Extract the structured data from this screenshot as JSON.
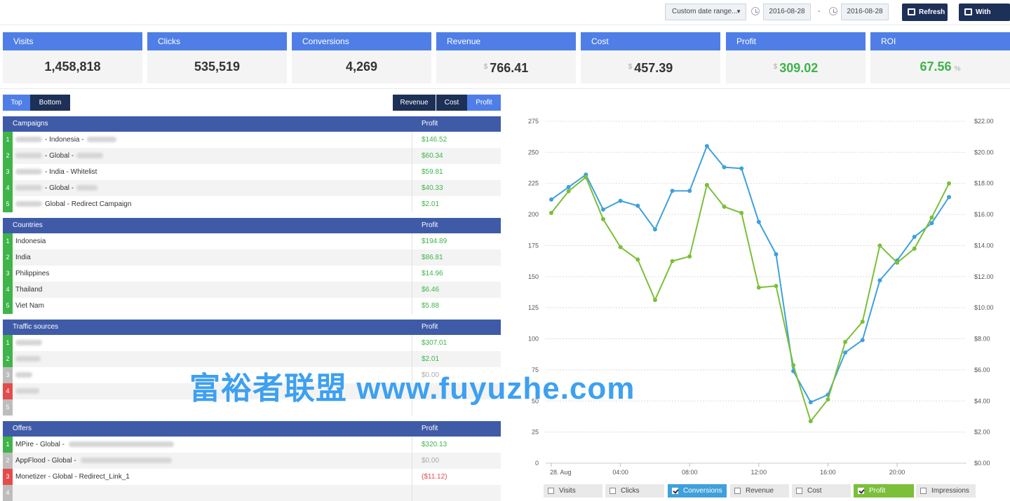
{
  "topbar": {
    "date_range_select": "Custom date range...",
    "date_from": "2016-08-28",
    "date_sep": "-",
    "date_to": "2016-08-28",
    "refresh_label": "Refresh",
    "with_traffic_label": "With traffic"
  },
  "kpis": [
    {
      "label": "Visits",
      "value": "1,458,818",
      "prefix": "",
      "suffix": ""
    },
    {
      "label": "Clicks",
      "value": "535,519",
      "prefix": "",
      "suffix": ""
    },
    {
      "label": "Conversions",
      "value": "4,269",
      "prefix": "",
      "suffix": ""
    },
    {
      "label": "Revenue",
      "value": "766.41",
      "prefix": "$",
      "suffix": ""
    },
    {
      "label": "Cost",
      "value": "457.39",
      "prefix": "$",
      "suffix": ""
    },
    {
      "label": "Profit",
      "value": "309.02",
      "prefix": "$",
      "suffix": ""
    },
    {
      "label": "ROI",
      "value": "67.56",
      "prefix": "",
      "suffix": "%"
    }
  ],
  "toggles": {
    "top": "Top",
    "bottom": "Bottom",
    "revenue": "Revenue",
    "cost": "Cost",
    "profit": "Profit"
  },
  "tables": [
    {
      "title": "Campaigns",
      "metric": "Profit",
      "rows": [
        {
          "rank": "1",
          "name": "- Indonesia -",
          "value": "$146.52",
          "status": "green"
        },
        {
          "rank": "2",
          "name": "- Global -",
          "value": "$60.34",
          "status": "green"
        },
        {
          "rank": "3",
          "name": "- India - Whitelist",
          "value": "$59.81",
          "status": "green"
        },
        {
          "rank": "4",
          "name": "- Global -",
          "value": "$40.33",
          "status": "green"
        },
        {
          "rank": "5",
          "name": "Global - Redirect Campaign",
          "value": "$2.01",
          "status": "green"
        }
      ]
    },
    {
      "title": "Countries",
      "metric": "Profit",
      "rows": [
        {
          "rank": "1",
          "name": "Indonesia",
          "value": "$194.89",
          "status": "green"
        },
        {
          "rank": "2",
          "name": "India",
          "value": "$86.81",
          "status": "green"
        },
        {
          "rank": "3",
          "name": "Philippines",
          "value": "$14.96",
          "status": "green"
        },
        {
          "rank": "4",
          "name": "Thailand",
          "value": "$6.46",
          "status": "green"
        },
        {
          "rank": "5",
          "name": "Viet Nam",
          "value": "$5.88",
          "status": "green"
        }
      ]
    },
    {
      "title": "Traffic sources",
      "metric": "Profit",
      "rows": [
        {
          "rank": "1",
          "name": "",
          "value": "$307.01",
          "status": "green"
        },
        {
          "rank": "2",
          "name": "",
          "value": "$2.01",
          "status": "green"
        },
        {
          "rank": "3",
          "name": "",
          "value": "$0.00",
          "status": "gray"
        },
        {
          "rank": "4",
          "name": "",
          "value": "",
          "status": "red"
        },
        {
          "rank": "5",
          "name": "",
          "value": "",
          "status": "gray"
        }
      ]
    },
    {
      "title": "Offers",
      "metric": "Profit",
      "rows": [
        {
          "rank": "1",
          "name": "MPire - Global -",
          "value": "$320.13",
          "status": "green"
        },
        {
          "rank": "2",
          "name": "AppFlood - Global -",
          "value": "$0.00",
          "status": "gray"
        },
        {
          "rank": "3",
          "name": "Monetizer - Global - Redirect_Link_1",
          "value": "($11.12)",
          "status": "red"
        },
        {
          "rank": "4",
          "name": "",
          "value": "",
          "status": "gray"
        }
      ]
    }
  ],
  "colors": {
    "green": "#3eb44a",
    "red": "#e54b4b",
    "gray": "#bdbdbd",
    "header": "#3f5ba8",
    "kpi": "#4f7fe6",
    "navy": "#1d3057"
  },
  "legend": [
    {
      "label": "Visits",
      "checked": false,
      "color": ""
    },
    {
      "label": "Clicks",
      "checked": false,
      "color": ""
    },
    {
      "label": "Conversions",
      "checked": true,
      "color": "#3fa0dc"
    },
    {
      "label": "Revenue",
      "checked": false,
      "color": ""
    },
    {
      "label": "Cost",
      "checked": false,
      "color": ""
    },
    {
      "label": "Profit",
      "checked": true,
      "color": "#7bbf3a"
    },
    {
      "label": "Impressions",
      "checked": false,
      "color": ""
    }
  ],
  "watermark": "富裕者联盟 www.fuyuzhe.com",
  "chart_data": {
    "type": "line",
    "x_tick_labels": [
      "28. Aug",
      "04:00",
      "08:00",
      "12:00",
      "16:00",
      "20:00"
    ],
    "x": [
      0,
      1,
      2,
      3,
      4,
      5,
      6,
      7,
      8,
      9,
      10,
      11,
      12,
      13,
      14,
      15,
      16,
      17,
      18,
      19,
      20,
      21,
      22,
      23
    ],
    "y_left_ticks": [
      "0",
      "25",
      "50",
      "75",
      "100",
      "125",
      "150",
      "175",
      "200",
      "225",
      "250",
      "275"
    ],
    "y_left_range": [
      0,
      275
    ],
    "y_right_ticks": [
      "$0.00",
      "$2.00",
      "$4.00",
      "$6.00",
      "$8.00",
      "$10.00",
      "$12.00",
      "$14.00",
      "$16.00",
      "$18.00",
      "$20.00",
      "$22.00"
    ],
    "y_right_range": [
      0,
      22
    ],
    "grid": true,
    "series": [
      {
        "name": "Conversions",
        "axis": "left",
        "color": "#3fa0dc",
        "values": [
          212,
          222,
          232,
          204,
          211,
          207,
          188,
          219,
          219,
          255,
          238,
          237,
          194,
          168,
          74,
          49,
          55,
          89,
          99,
          147,
          163,
          182,
          193,
          214
        ]
      },
      {
        "name": "Profit",
        "axis": "right",
        "color": "#7bbf3a",
        "values": [
          16.1,
          17.5,
          18.4,
          15.7,
          13.9,
          13.1,
          10.5,
          13.0,
          13.3,
          17.9,
          16.5,
          16.1,
          11.3,
          11.4,
          6.3,
          2.7,
          4.1,
          7.8,
          9.1,
          14.0,
          12.9,
          13.8,
          15.8,
          18.0
        ]
      }
    ]
  }
}
